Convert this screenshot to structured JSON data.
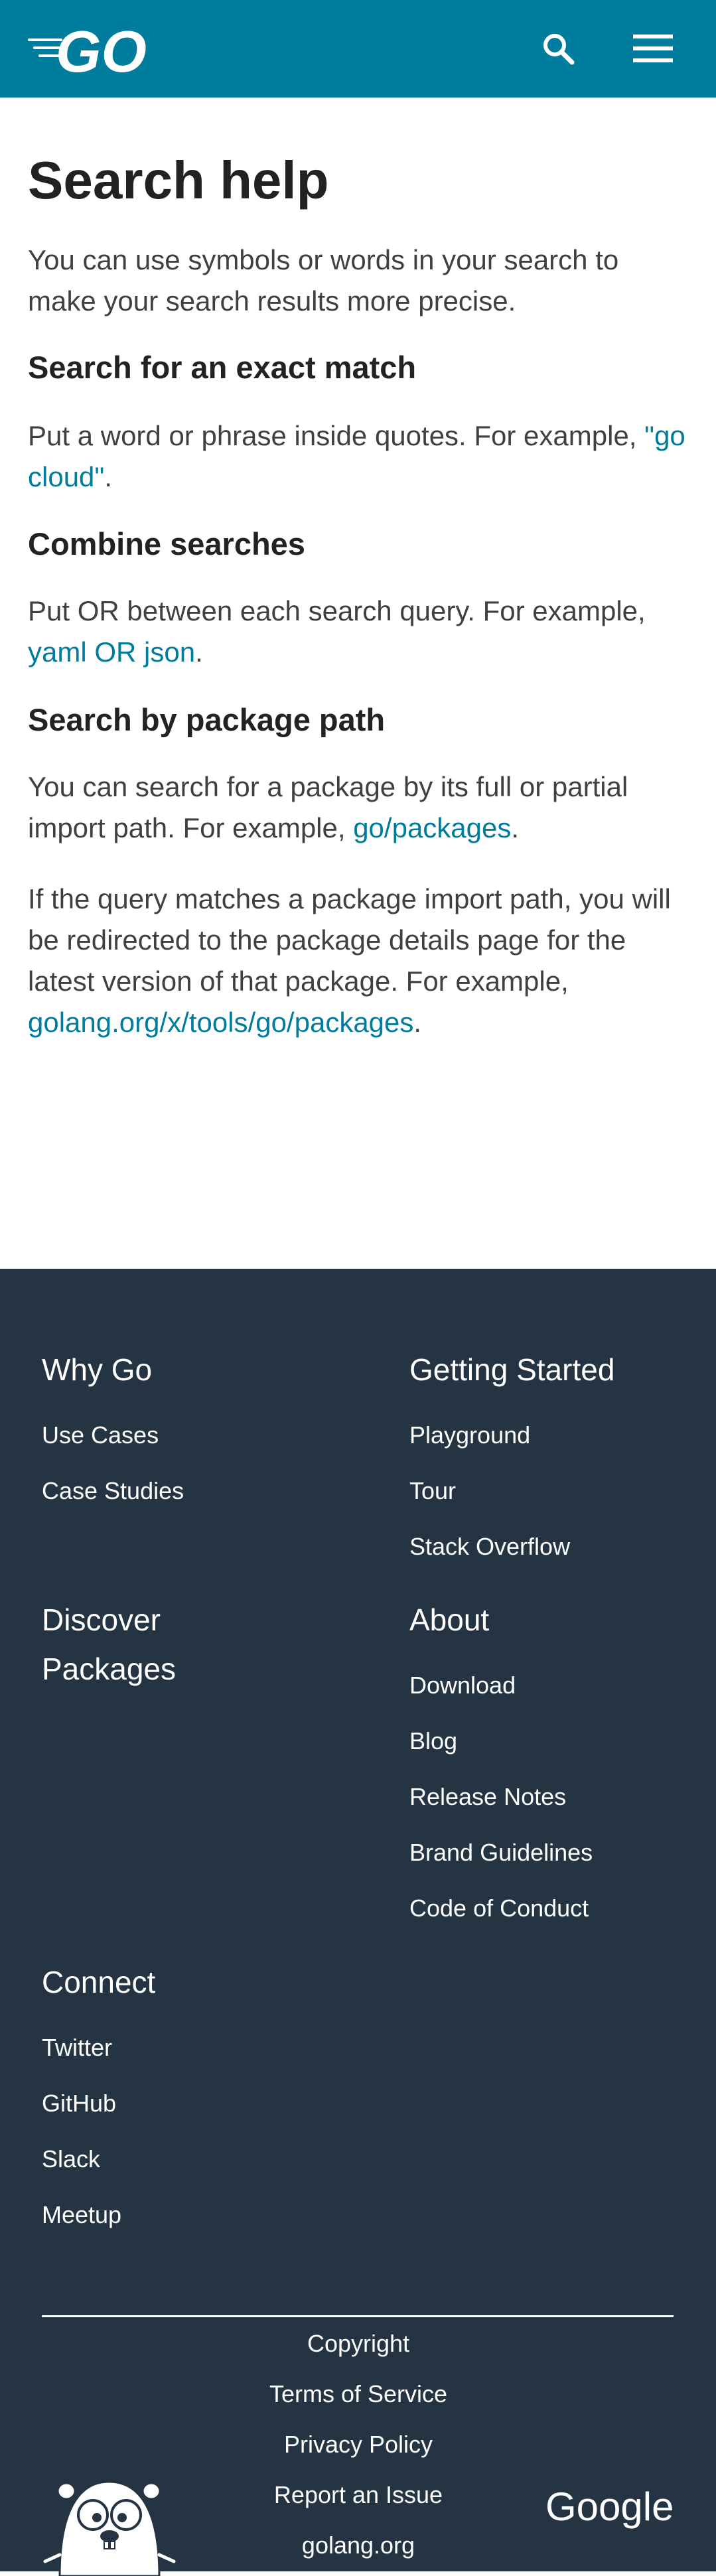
{
  "header": {
    "logo_text": "GO",
    "icons": {
      "search": "search-icon",
      "menu": "menu-icon"
    },
    "bg_color": "#007d9c"
  },
  "main": {
    "title": "Search help",
    "intro": "You can use symbols or words in your search to make your search results more precise.",
    "exact": {
      "heading": "Search for an exact match",
      "text": "Put a word or phrase inside quotes. For example, ",
      "link": "\"go cloud\"",
      "after": "."
    },
    "combine": {
      "heading": "Combine searches",
      "text": "Put OR between each search query. For example, ",
      "link": "yaml OR json",
      "after": "."
    },
    "path": {
      "heading": "Search by package path",
      "text1": "You can search for a package by its full or partial import path. For example, ",
      "link1": "go/packages",
      "after1": ".",
      "text2": "If the query matches a package import path, you will be redirected to the package details page for the latest version of that package. For example, ",
      "link2": "golang.org/x/tools/go/packages",
      "after2": "."
    },
    "link_color": "#007d9c"
  },
  "footer": {
    "bg_color": "#253443",
    "why_go": {
      "heading": "Why Go",
      "links": [
        "Use Cases",
        "Case Studies"
      ]
    },
    "getting_started": {
      "heading": "Getting Started",
      "links": [
        "Playground",
        "Tour",
        "Stack Overflow"
      ]
    },
    "discover": {
      "heading_line1": "Discover",
      "heading_line2": "Packages"
    },
    "about": {
      "heading": "About",
      "links": [
        "Download",
        "Blog",
        "Release Notes",
        "Brand Guidelines",
        "Code of Conduct"
      ]
    },
    "connect": {
      "heading": "Connect",
      "links": [
        "Twitter",
        "GitHub",
        "Slack",
        "Meetup"
      ]
    },
    "bottom_links": [
      "Copyright",
      "Terms of Service",
      "Privacy Policy",
      "Report an Issue",
      "golang.org"
    ],
    "google_logo_text": "Google",
    "mascot_icon": "gopher-icon"
  }
}
